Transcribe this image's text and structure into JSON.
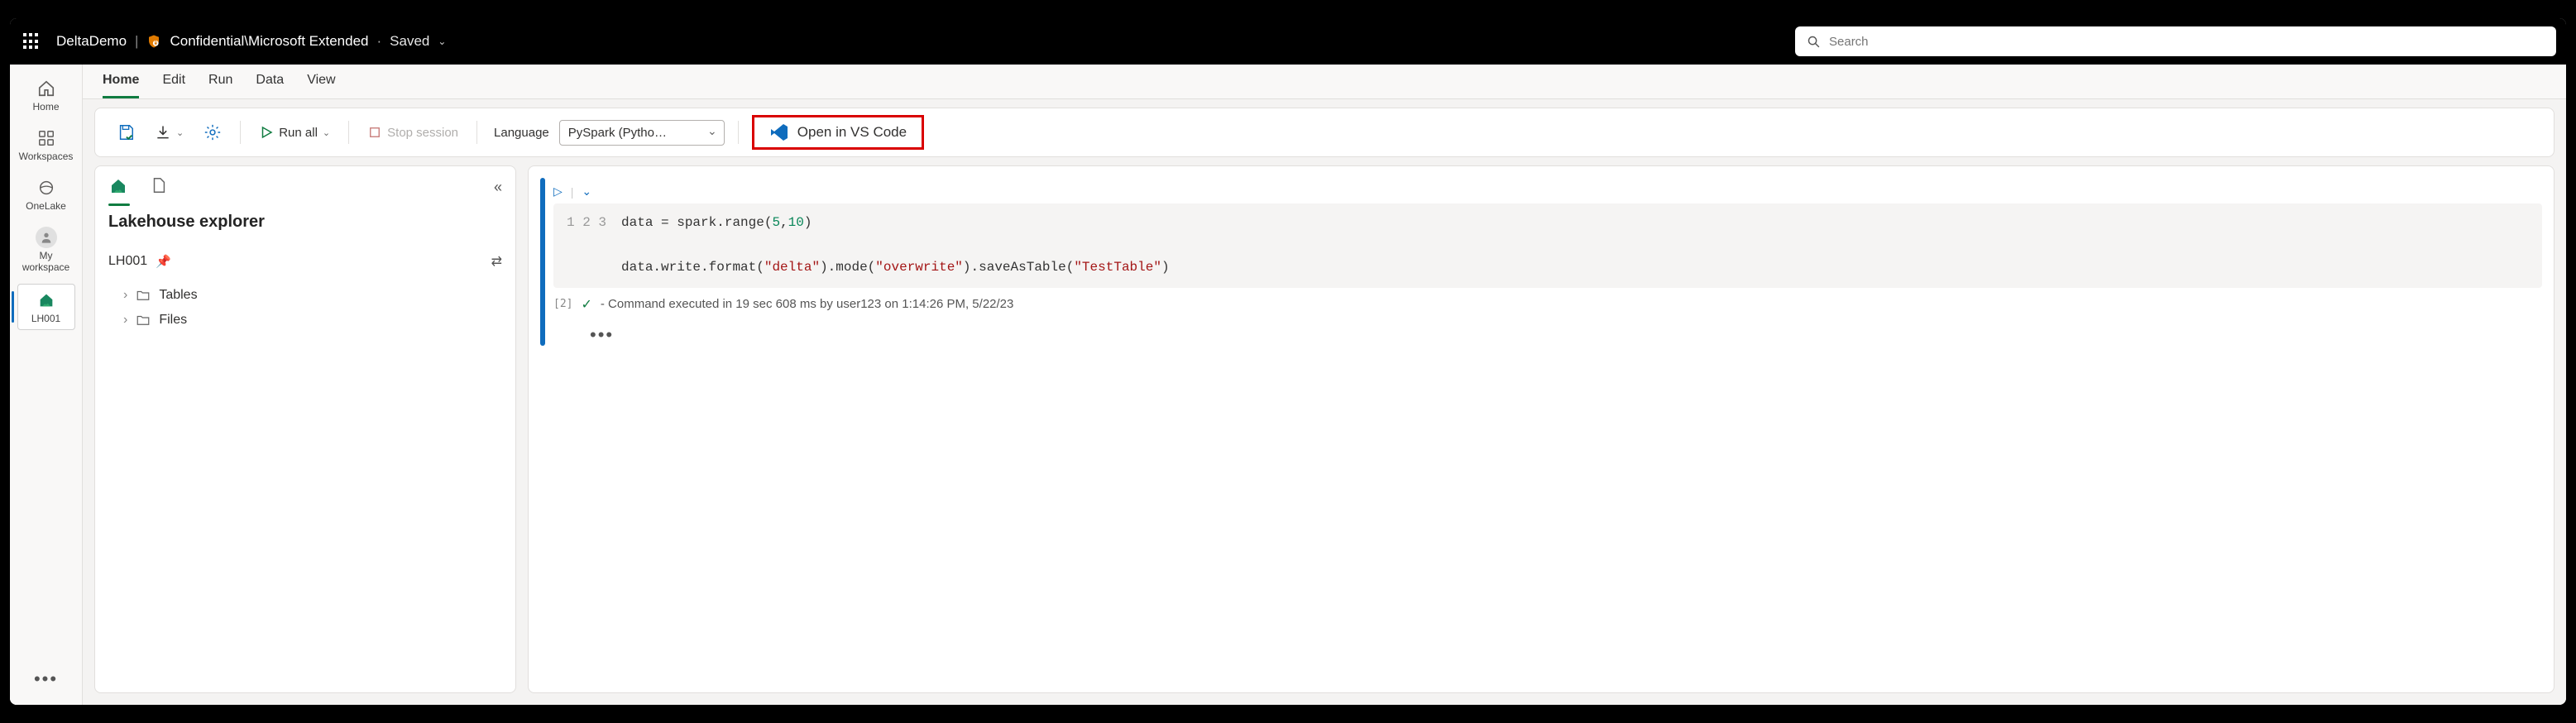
{
  "titlebar": {
    "doc_name": "DeltaDemo",
    "classification": "Confidential\\Microsoft Extended",
    "save_state": "Saved",
    "search_placeholder": "Search"
  },
  "left_rail": {
    "items": [
      {
        "label": "Home",
        "icon": "home"
      },
      {
        "label": "Workspaces",
        "icon": "workspaces"
      },
      {
        "label": "OneLake",
        "icon": "onelake"
      },
      {
        "label": "My workspace",
        "icon": "person"
      },
      {
        "label": "LH001",
        "icon": "lakehouse"
      }
    ]
  },
  "menu_tabs": [
    {
      "label": "Home",
      "active": true
    },
    {
      "label": "Edit",
      "active": false
    },
    {
      "label": "Run",
      "active": false
    },
    {
      "label": "Data",
      "active": false
    },
    {
      "label": "View",
      "active": false
    }
  ],
  "toolbar": {
    "run_all_label": "Run all",
    "stop_session_label": "Stop session",
    "language_label": "Language",
    "language_value": "PySpark (Pytho…",
    "open_vscode_label": "Open in VS Code"
  },
  "explorer": {
    "title": "Lakehouse explorer",
    "root": "LH001",
    "folders": [
      {
        "label": "Tables"
      },
      {
        "label": "Files"
      }
    ]
  },
  "notebook": {
    "exec_count": "[2]",
    "status": "- Command executed in 19 sec 608 ms by user123 on 1:14:26 PM, 5/22/23",
    "code_lines": [
      {
        "n": "1",
        "segments": [
          {
            "t": "data = spark.range(",
            "c": "default"
          },
          {
            "t": "5",
            "c": "num"
          },
          {
            "t": ",",
            "c": "default"
          },
          {
            "t": "10",
            "c": "num"
          },
          {
            "t": ")",
            "c": "default"
          }
        ]
      },
      {
        "n": "2",
        "segments": []
      },
      {
        "n": "3",
        "segments": [
          {
            "t": "data.write.format(",
            "c": "default"
          },
          {
            "t": "\"delta\"",
            "c": "str"
          },
          {
            "t": ").mode(",
            "c": "default"
          },
          {
            "t": "\"overwrite\"",
            "c": "str"
          },
          {
            "t": ").saveAsTable(",
            "c": "default"
          },
          {
            "t": "\"TestTable\"",
            "c": "str"
          },
          {
            "t": ")",
            "c": "default"
          }
        ]
      }
    ]
  }
}
